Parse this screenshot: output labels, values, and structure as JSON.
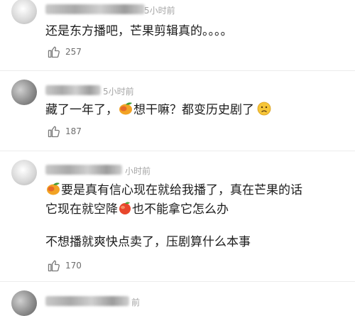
{
  "comments": [
    {
      "time": "5小时前",
      "line1": "还是东方播吧，芒果剪辑真的。。。。",
      "likes": "257"
    },
    {
      "time": "5小时前",
      "line1_a": "藏了一年了，",
      "line1_b": "想干嘛？都变历史剧了",
      "likes": "187"
    },
    {
      "time": "小时前",
      "line1": "要是真有信心现在就给我播了，真在芒果的话",
      "line2_a": "它现在就空降",
      "line2_b": "也不能拿它怎么办",
      "line3": "不想播就爽快点卖了，压剧算什么本事",
      "likes": "170"
    },
    {
      "time": "前"
    }
  ],
  "icons": {
    "like": "thumbs-up-icon",
    "mango": "mango-emoji-icon",
    "sad": "sad-face-emoji-icon",
    "peach": "peach-emoji-icon"
  }
}
